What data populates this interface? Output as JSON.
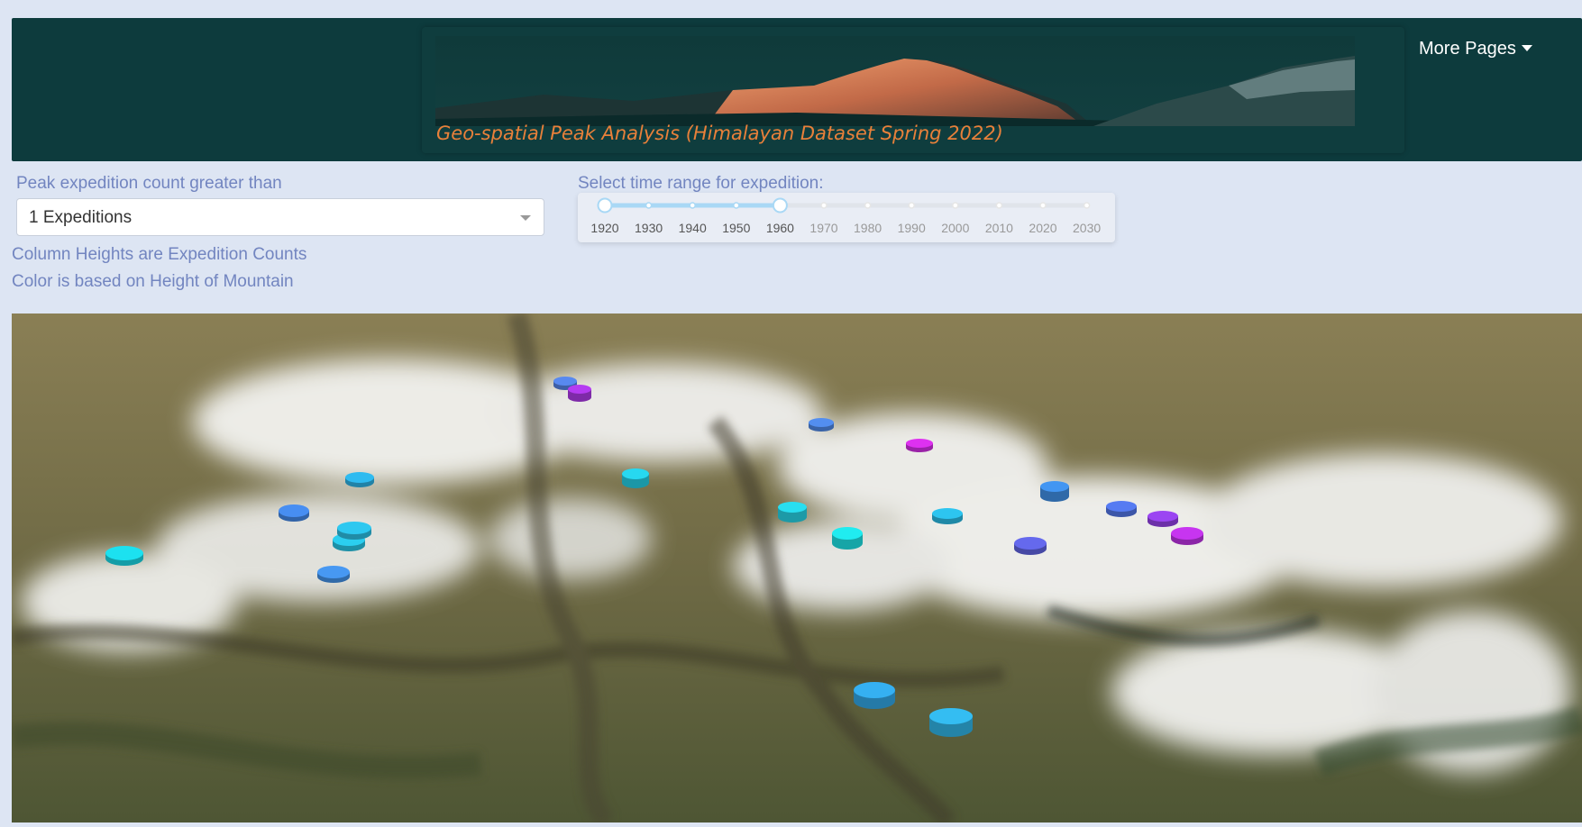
{
  "header": {
    "title": "Geo-spatial Peak Analysis (Himalayan Dataset Spring 2022)",
    "more_pages_label": "More Pages"
  },
  "filters": {
    "count_label": "Peak expedition count greater than",
    "count_value": "1 Expeditions",
    "note_height": "Column Heights are Expedition Counts",
    "note_color": "Color is based on Height of Mountain",
    "time_label": "Select time range for expedition:",
    "time_ticks": [
      "1920",
      "1930",
      "1940",
      "1950",
      "1960",
      "1970",
      "1980",
      "1990",
      "2000",
      "2010",
      "2020",
      "2030"
    ],
    "time_range": [
      1920,
      1960
    ]
  },
  "colors": {
    "navbar": "#0d3b3d",
    "title": "#e8803a",
    "label": "#7285c0",
    "slider_active": "#a9d8f5",
    "slider_inactive": "#999999"
  },
  "map": {
    "columns": [
      {
        "color": "#19c9d6"
      },
      {
        "color": "#3f7fd8"
      },
      {
        "color": "#26b8d6"
      },
      {
        "color": "#3f88d8"
      },
      {
        "color": "#2aa7d6"
      },
      {
        "color": "#29b3d6"
      },
      {
        "color": "#4f7ad6"
      },
      {
        "color": "#a236d8"
      },
      {
        "color": "#23c1d6"
      },
      {
        "color": "#4a7fd6"
      },
      {
        "color": "#25c6d6"
      },
      {
        "color": "#1dd3d6"
      },
      {
        "color": "#c62cd6"
      },
      {
        "color": "#28b0d6"
      },
      {
        "color": "#3c86d8"
      },
      {
        "color": "#5a5ed4"
      },
      {
        "color": "#4d6ed8"
      },
      {
        "color": "#8a3ed8"
      },
      {
        "color": "#b22fd6"
      },
      {
        "color": "#2f9dd8"
      },
      {
        "color": "#2ea9d8"
      }
    ]
  }
}
